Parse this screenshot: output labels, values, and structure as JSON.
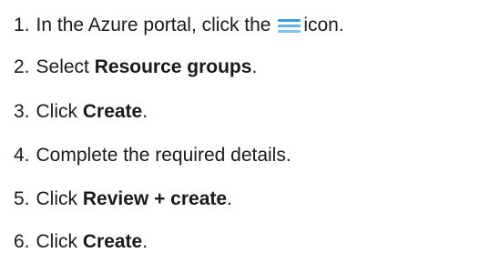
{
  "steps": [
    {
      "number": "1.",
      "before": "In the Azure portal, click the",
      "icon": "hamburger-menu-icon",
      "after": "icon."
    },
    {
      "number": "2.",
      "before": "Select ",
      "bold": "Resource groups",
      "after": "."
    },
    {
      "number": "3.",
      "before": "Click ",
      "bold": "Create",
      "after": "."
    },
    {
      "number": "4.",
      "before": "Complete the required details."
    },
    {
      "number": "5.",
      "before": "Click ",
      "bold": "Review + create",
      "after": "."
    },
    {
      "number": "6.",
      "before": "Click ",
      "bold": "Create",
      "after": "."
    }
  ],
  "colors": {
    "text": "#1a1a1a",
    "icon_accent": "#3aa0e0"
  }
}
